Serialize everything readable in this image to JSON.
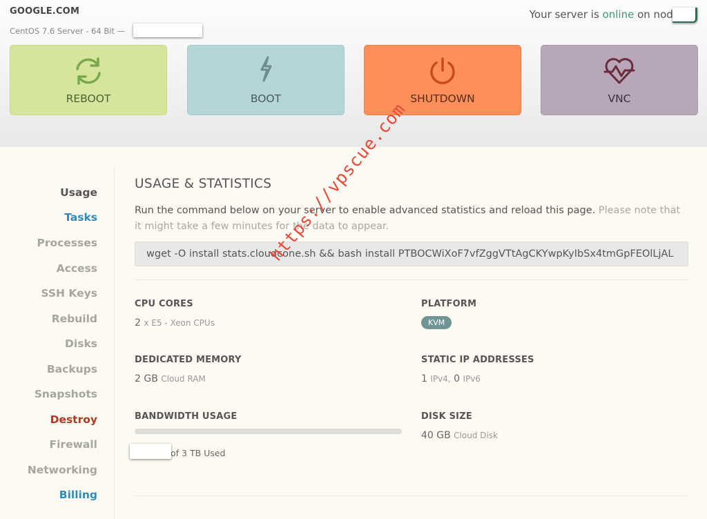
{
  "header": {
    "domain": "GOOGLE.COM",
    "os": "CentOS 7.6 Server - 64 Bit —",
    "status_prefix": "Your server is",
    "status_online": "online",
    "status_suffix": "on node",
    "actions": [
      {
        "label": "REBOOT",
        "icon": "reboot-icon",
        "color": "#d6e59c"
      },
      {
        "label": "BOOT",
        "icon": "bolt-icon",
        "color": "#b4d6d7"
      },
      {
        "label": "SHUTDOWN",
        "icon": "power-icon",
        "color": "#fc8f5a"
      },
      {
        "label": "VNC",
        "icon": "heartbeat-icon",
        "color": "#b8a7b8"
      }
    ]
  },
  "sidebar": {
    "items": [
      {
        "label": "Usage"
      },
      {
        "label": "Tasks"
      },
      {
        "label": "Processes"
      },
      {
        "label": "Access"
      },
      {
        "label": "SSH Keys"
      },
      {
        "label": "Rebuild"
      },
      {
        "label": "Disks"
      },
      {
        "label": "Backups"
      },
      {
        "label": "Snapshots"
      },
      {
        "label": "Destroy"
      },
      {
        "label": "Firewall"
      },
      {
        "label": "Networking"
      },
      {
        "label": "Billing"
      }
    ]
  },
  "main": {
    "title": "USAGE & STATISTICS",
    "desc": "Run the command below on your server to enable advanced statistics and reload this page.",
    "note": "Please note that it might take a few minutes for the data to appear.",
    "command": "wget -O install stats.cloudcone.sh && bash install PTBOCWiXoF7vfZggVTtAgCKYwpKyIbSx4tmGpFEOlLjAL",
    "stats": {
      "cpu": {
        "heading": "CPU CORES",
        "value": "2",
        "unit": "x E5 - Xeon CPUs"
      },
      "platform": {
        "heading": "PLATFORM",
        "badge": "KVM"
      },
      "memory": {
        "heading": "DEDICATED MEMORY",
        "value": "2 GB",
        "unit": "Cloud RAM"
      },
      "ip": {
        "heading": "STATIC IP ADDRESSES",
        "v4": "1",
        "v4_unit": "IPv4,",
        "v6": "0",
        "v6_unit": "IPv6"
      },
      "bandwidth": {
        "heading": "BANDWIDTH USAGE",
        "used_text": "of 3 TB Used"
      },
      "disk": {
        "heading": "DISK SIZE",
        "value": "40 GB",
        "unit": "Cloud Disk"
      }
    }
  },
  "watermark": "https://vpscue.com"
}
